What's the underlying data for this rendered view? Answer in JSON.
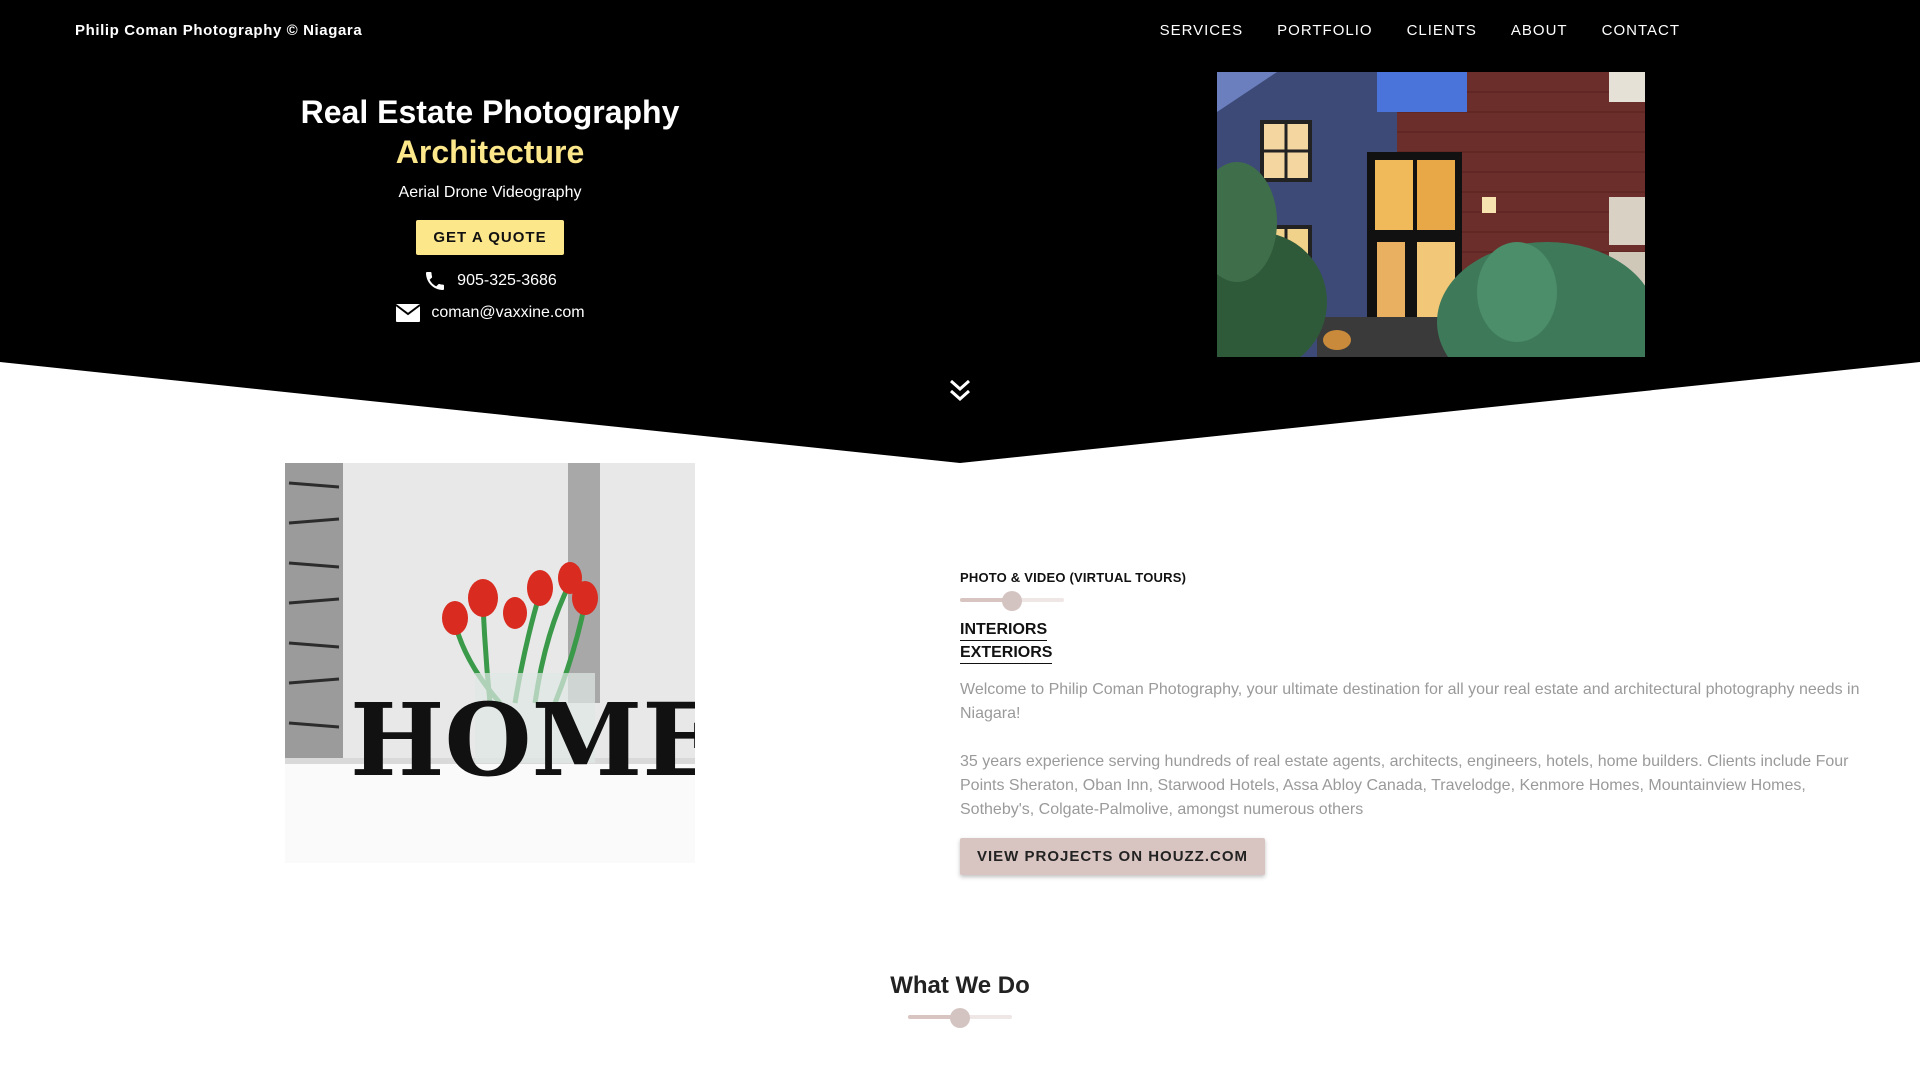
{
  "header": {
    "brand": "Philip Coman Photography © Niagara",
    "nav": [
      "SERVICES",
      "PORTFOLIO",
      "CLIENTS",
      "ABOUT",
      "CONTACT"
    ]
  },
  "hero": {
    "title": "Real Estate Photography",
    "subtitle": "Architecture",
    "tagline": "Aerial Drone Videography",
    "quote_button": "GET A QUOTE",
    "phone": "905-325-3686",
    "email": "coman@vaxxine.com"
  },
  "about": {
    "label": "PHOTO & VIDEO (VIRTUAL TOURS)",
    "links": [
      "INTERIORS",
      "EXTERIORS"
    ],
    "paragraphs": [
      "Welcome to Philip Coman Photography, your ultimate destination for all your real estate and architectural photography needs in Niagara!",
      "35 years experience serving hundreds of real estate agents, architects, engineers, hotels, home builders. Clients include Four Points Sheraton, Oban Inn, Starwood Hotels, Assa Abloy Canada, Travelodge, Kenmore Homes, Mountainview Homes, Sotheby's, Colgate-Palmolive, amongst numerous others"
    ],
    "houzz_button": "VIEW PROJECTS ON HOUZZ.COM",
    "photo_text": "HOME"
  },
  "what_we_do": {
    "heading": "What We Do"
  },
  "icons": {
    "phone": "phone-icon",
    "email": "envelope-icon",
    "scroll": "double-chevron-down-icon"
  },
  "colors": {
    "hero_bg": "#000000",
    "accent_yellow": "#fce78a",
    "accent_rose": "#d8c5c2",
    "body_text": "#9a9a9a"
  }
}
